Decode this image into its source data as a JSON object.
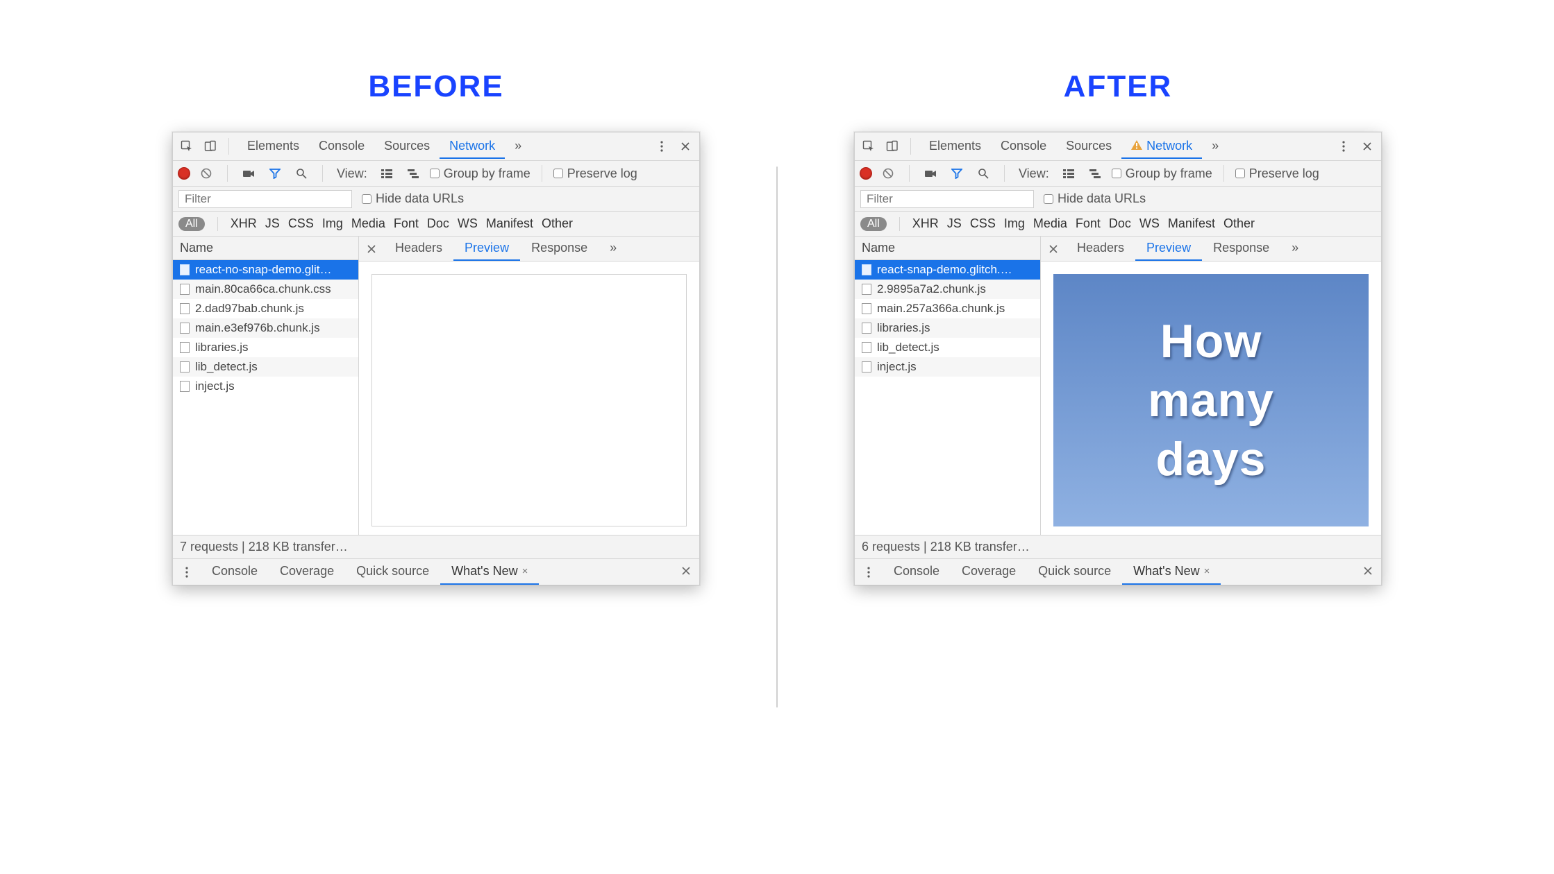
{
  "headings": {
    "before": "BEFORE",
    "after": "AFTER"
  },
  "top_tabs": {
    "elements": "Elements",
    "console": "Console",
    "sources": "Sources",
    "network": "Network"
  },
  "net_toolbar": {
    "view_label": "View:",
    "group_by_frame": "Group by frame",
    "preserve_log": "Preserve log"
  },
  "filter": {
    "placeholder": "Filter",
    "hide_data_urls": "Hide data URLs"
  },
  "types": {
    "all": "All",
    "xhr": "XHR",
    "js": "JS",
    "css": "CSS",
    "img": "Img",
    "media": "Media",
    "font": "Font",
    "doc": "Doc",
    "ws": "WS",
    "manifest": "Manifest",
    "other": "Other"
  },
  "detail_tabs": {
    "headers": "Headers",
    "preview": "Preview",
    "response": "Response"
  },
  "columns": {
    "name": "Name"
  },
  "drawer": {
    "console": "Console",
    "coverage": "Coverage",
    "quick_source": "Quick source",
    "whats_new": "What's New"
  },
  "before": {
    "requests": [
      "react-no-snap-demo.glit…",
      "main.80ca66ca.chunk.css",
      "2.dad97bab.chunk.js",
      "main.e3ef976b.chunk.js",
      "libraries.js",
      "lib_detect.js",
      "inject.js"
    ],
    "status": "7 requests | 218 KB transfer…"
  },
  "after": {
    "requests": [
      "react-snap-demo.glitch.…",
      "2.9895a7a2.chunk.js",
      "main.257a366a.chunk.js",
      "libraries.js",
      "lib_detect.js",
      "inject.js"
    ],
    "status": "6 requests | 218 KB transfer…",
    "poster_lines": [
      "How",
      "many",
      "days"
    ]
  }
}
